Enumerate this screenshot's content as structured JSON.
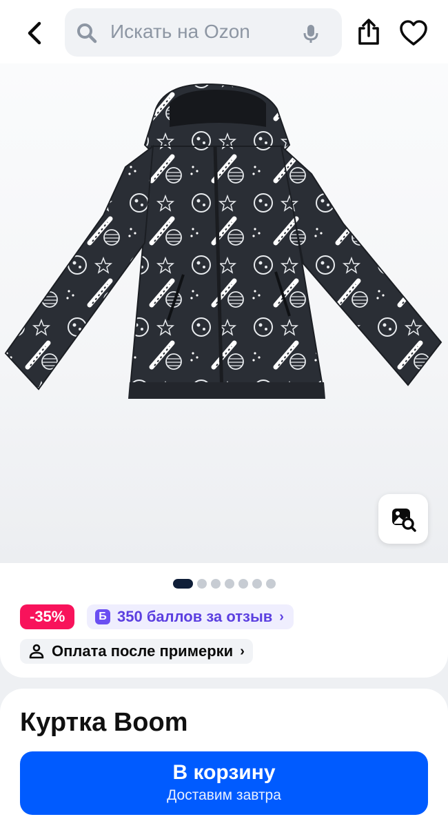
{
  "header": {
    "search_placeholder": "Искать на Ozon",
    "back_icon": "chevron-left-icon",
    "search_icon": "search-icon",
    "mic_icon": "microphone-icon",
    "share_icon": "share-icon",
    "favorite_icon": "heart-icon"
  },
  "gallery": {
    "image_count": 7,
    "active_index": 0,
    "similar_search_icon": "image-search-icon"
  },
  "badges": {
    "discount": "-35%",
    "review_icon_letter": "Б",
    "review_bonus": "350 баллов за отзыв",
    "review_chevron": "›",
    "fitting": "Оплата после примерки",
    "fitting_chevron": "›",
    "fitting_icon": "hanger-icon"
  },
  "product": {
    "title": "Куртка Boom"
  },
  "cart": {
    "label": "В корзину",
    "delivery": "Доставим завтра"
  },
  "colors": {
    "accent": "#005bff",
    "discount": "#f8135b",
    "bonus": "#5b3fe0"
  }
}
